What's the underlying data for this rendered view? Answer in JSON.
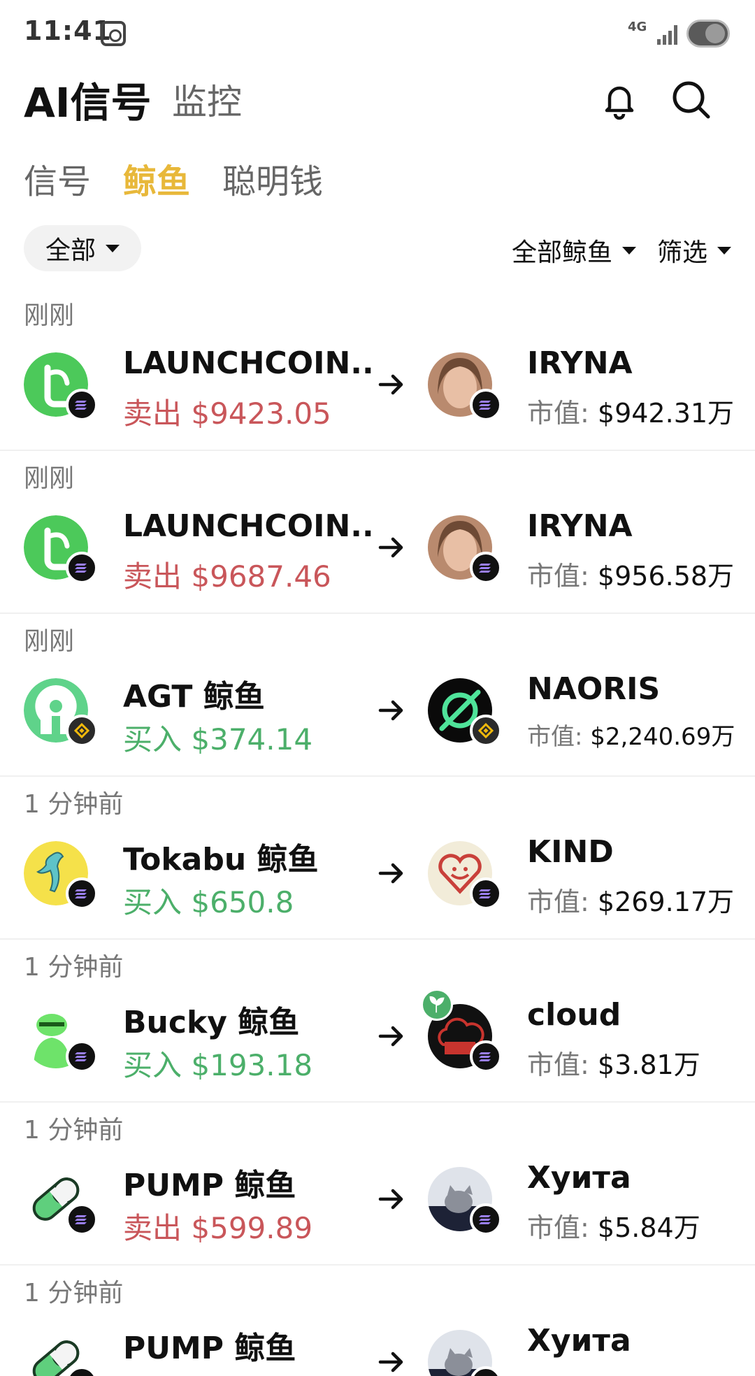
{
  "status": {
    "time": "11:41",
    "network": "4G"
  },
  "header": {
    "title": "AI信号",
    "monitor_tab": "监控"
  },
  "subtabs": [
    "信号",
    "鲸鱼",
    "聪明钱"
  ],
  "filters": {
    "all": "全部",
    "whale_filter": "全部鲸鱼",
    "screen": "筛选"
  },
  "mcap_label": "市值:",
  "colors": {
    "accent": "#e8b83a",
    "sell": "#c9565a",
    "buy": "#4caf6a"
  },
  "entries": [
    {
      "time": "刚刚",
      "whale": "LAUNCHCOIN...",
      "action": "卖出",
      "amount": "$9423.05",
      "side": "sell",
      "token": "IRYNA",
      "mcap": "$942.31万",
      "chain": "solana"
    },
    {
      "time": "刚刚",
      "whale": "LAUNCHCOIN...",
      "action": "卖出",
      "amount": "$9687.46",
      "side": "sell",
      "token": "IRYNA",
      "mcap": "$956.58万",
      "chain": "solana"
    },
    {
      "time": "刚刚",
      "whale": "AGT 鲸鱼",
      "action": "买入",
      "amount": "$374.14",
      "side": "buy",
      "token": "NAORIS",
      "mcap": "$2,240.69万",
      "chain": "bnb"
    },
    {
      "time": "1 分钟前",
      "whale": "Tokabu 鲸鱼",
      "action": "买入",
      "amount": "$650.8",
      "side": "buy",
      "token": "KIND",
      "mcap": "$269.17万",
      "chain": "solana"
    },
    {
      "time": "1 分钟前",
      "whale": "Bucky 鲸鱼",
      "action": "买入",
      "amount": "$193.18",
      "side": "buy",
      "token": "cloud",
      "mcap": "$3.81万",
      "chain": "solana"
    },
    {
      "time": "1 分钟前",
      "whale": "PUMP 鲸鱼",
      "action": "卖出",
      "amount": "$599.89",
      "side": "sell",
      "token": "Хуита",
      "mcap": "$5.84万",
      "chain": "solana"
    },
    {
      "time": "1 分钟前",
      "whale": "PUMP 鲸鱼",
      "action": "",
      "amount": "",
      "side": "sell",
      "token": "Хуита",
      "mcap": "",
      "chain": "solana"
    }
  ]
}
